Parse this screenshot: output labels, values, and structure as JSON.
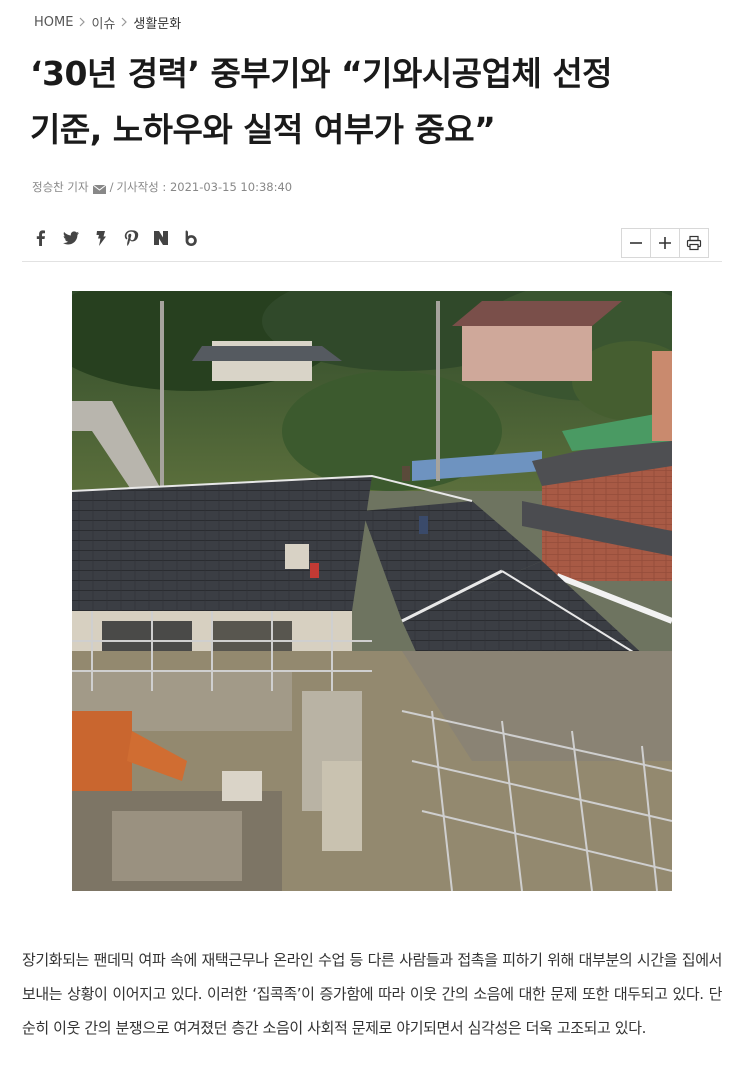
{
  "breadcrumb": {
    "items": [
      "HOME",
      "이슈",
      "생활문화"
    ]
  },
  "article": {
    "headline_line1": "‘30년 경력’ 중부기와 “기와시공업체 선정",
    "headline_line2": "기준, 노하우와 실적 여부가 중요”",
    "author": "정승찬 기자",
    "published_label": "기사작성 : 2021-03-15 10:38:40",
    "body": "장기화되는 팬데믹 여파 속에 재택근무나 온라인 수업 등 다른 사람들과 접촉을 피하기 위해 대부분의 시간을 집에서 보내는 상황이 이어지고 있다. 이러한 ‘집콕족’이 증가함에 따라 이웃 간의 소음에 대한 문제 또한 대두되고 있다. 단순히 이웃 간의 분쟁으로 여겨졌던 층간 소음이 사회적 문제로 야기되면서 심각성은 더욱 고조되고 있다."
  },
  "share_icons": [
    "facebook-icon",
    "twitter-icon",
    "kakaostory-icon",
    "pinterest-icon",
    "naver-icon",
    "band-icon"
  ],
  "tools": {
    "icons": [
      "font-decrease-icon",
      "font-increase-icon",
      "print-icon"
    ]
  },
  "colors": {
    "roof": "#3a3d42",
    "headline": "#1a1a1a",
    "meta": "#888888"
  }
}
